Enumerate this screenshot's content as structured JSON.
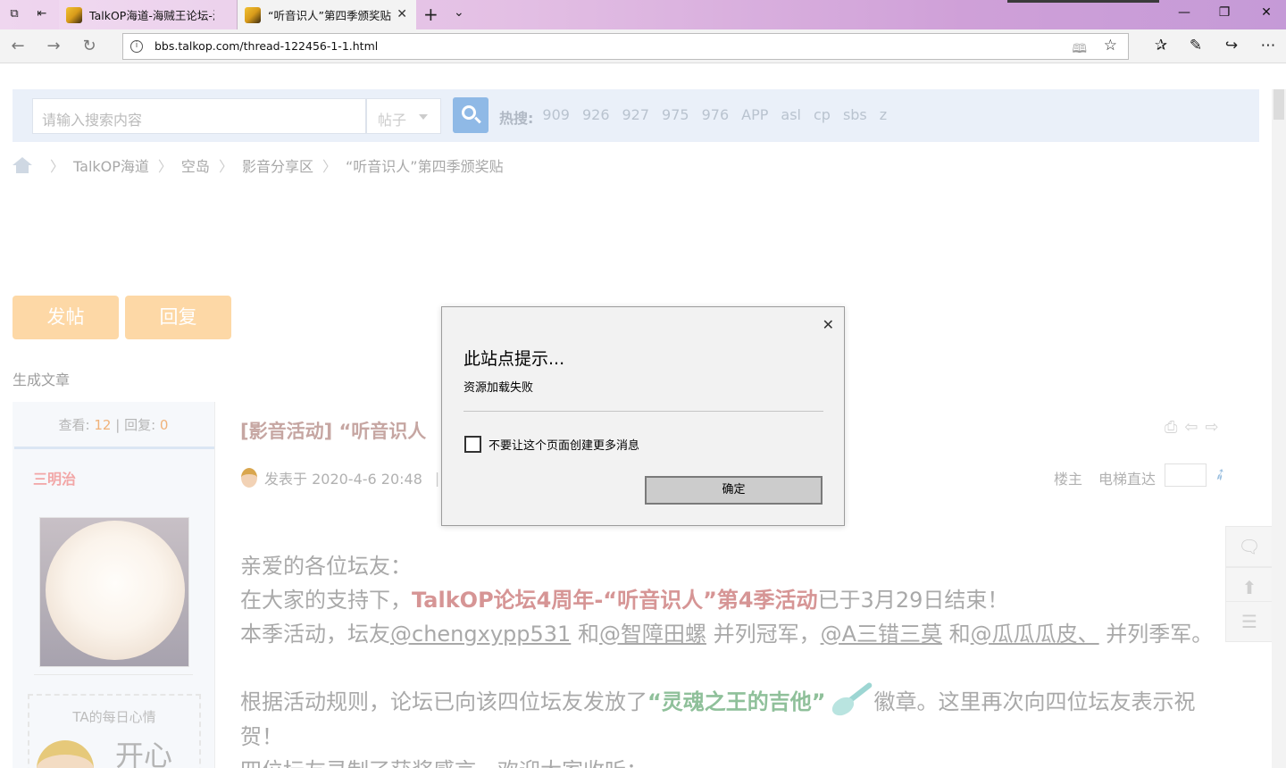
{
  "browser": {
    "tabs": [
      {
        "label": "TalkOP海道-海贼王论坛-海贼",
        "active": false
      },
      {
        "label": "“听音识人”第四季颁奖贴",
        "active": true
      }
    ],
    "url": "bbs.talkop.com/thread-122456-1-1.html",
    "accent_titlebar": "#d9b3e3"
  },
  "search": {
    "placeholder": "请输入搜索内容",
    "type_select": "帖子",
    "hot_label": "热搜:",
    "hot_terms": [
      "909",
      "926",
      "927",
      "975",
      "976",
      "APP",
      "asl",
      "cp",
      "sbs",
      "z"
    ]
  },
  "breadcrumb": [
    "TalkOP海道",
    "空岛",
    "影音分享区",
    "“听音识人”第四季颁奖贴"
  ],
  "actions": {
    "post": "发帖",
    "reply": "回复",
    "generate_article": "生成文章"
  },
  "author_panel": {
    "views_label": "查看:",
    "views": "12",
    "divider": "|",
    "replies_label": "回复:",
    "replies": "0",
    "username": "三明治",
    "mood_title": "TA的每日心情",
    "mood_value": "开心"
  },
  "post": {
    "title": "[影音活动] “听音识人",
    "posted_at": "发表于 2020-4-6 20:48",
    "meta_sep": "|",
    "floor_label": "楼主",
    "elevator_label": "电梯直达",
    "p1": "亲爱的各位坛友：",
    "p2_pre": "在大家的支持下，",
    "p2_hl": "TalkOP论坛4周年-“听音识人”第4季活动",
    "p2_post": "已于3月29日结束！",
    "p3_a": "本季活动，坛友",
    "p3_u1": "@chengxypp531",
    "p3_b": " 和",
    "p3_u2": "@智障田螺",
    "p3_c": " 并列冠军，",
    "p3_u3": "@A三错三莫",
    "p3_d": " 和",
    "p3_u4": "@瓜瓜瓜皮、",
    "p3_e": " 并列季军。",
    "p4_pre": "根据活动规则，论坛已向该四位坛友发放了",
    "p4_hl": "“灵魂之王的吉他”",
    "p4_post": "徽章。这里再次向四位坛友表示祝贺！",
    "p5": "四位坛友录制了获奖感言，欢迎大家收听："
  },
  "dialog": {
    "title": "此站点提示...",
    "message": "资源加载失败",
    "checkbox_label": "不要让这个页面创建更多消息",
    "checkbox_checked": false,
    "ok_label": "确定"
  }
}
